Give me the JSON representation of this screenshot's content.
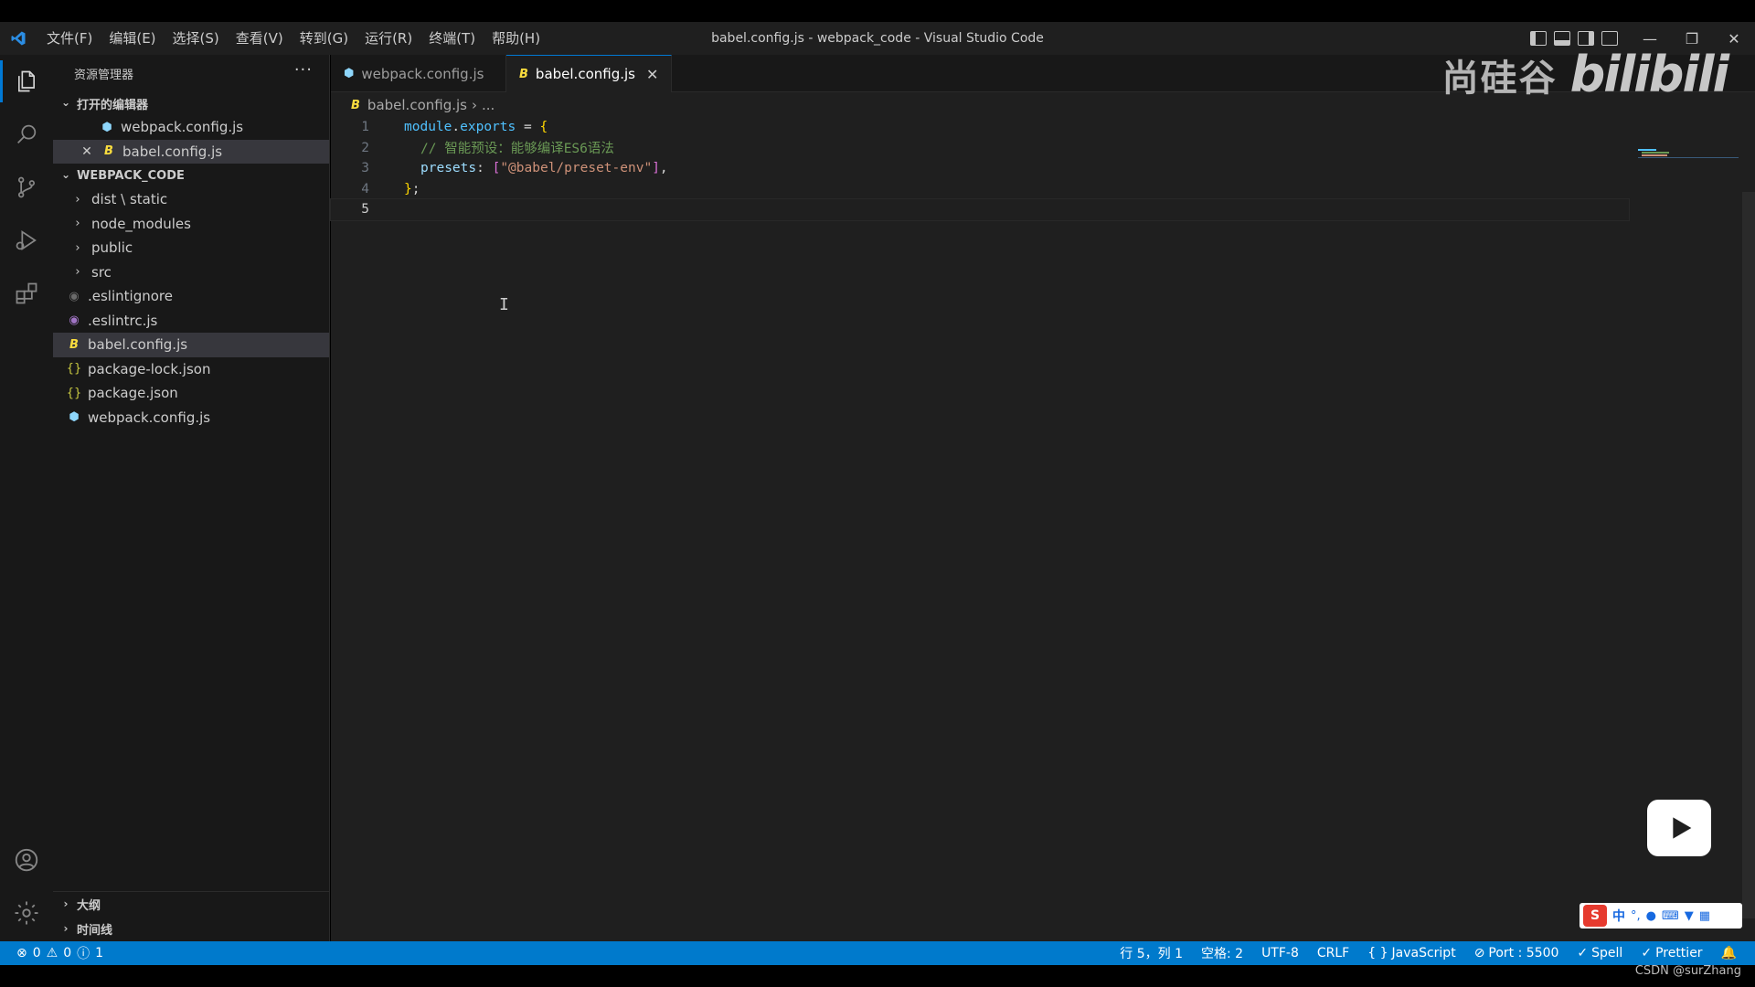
{
  "window": {
    "title": "babel.config.js - webpack_code - Visual Studio Code"
  },
  "menu": [
    "文件(F)",
    "编辑(E)",
    "选择(S)",
    "查看(V)",
    "转到(G)",
    "运行(R)",
    "终端(T)",
    "帮助(H)"
  ],
  "sidebar": {
    "header": "资源管理器",
    "more": "···",
    "open_editors": {
      "title": "打开的编辑器",
      "items": [
        {
          "label": "webpack.config.js",
          "icon": "webpack-icon"
        },
        {
          "label": "babel.config.js",
          "icon": "babel-icon",
          "selected": true
        }
      ]
    },
    "project": {
      "title": "WEBPACK_CODE",
      "items": [
        {
          "label": "dist \\ static",
          "type": "folder"
        },
        {
          "label": "node_modules",
          "type": "folder"
        },
        {
          "label": "public",
          "type": "folder"
        },
        {
          "label": "src",
          "type": "folder"
        },
        {
          "label": ".eslintignore",
          "type": "file",
          "icon": "eslintignore-icon"
        },
        {
          "label": ".eslintrc.js",
          "type": "file",
          "icon": "eslint-icon"
        },
        {
          "label": "babel.config.js",
          "type": "file",
          "icon": "babel-icon",
          "selected": true
        },
        {
          "label": "package-lock.json",
          "type": "file",
          "icon": "json-icon"
        },
        {
          "label": "package.json",
          "type": "file",
          "icon": "json-icon"
        },
        {
          "label": "webpack.config.js",
          "type": "file",
          "icon": "webpack-icon"
        }
      ]
    },
    "bottom": [
      "大纲",
      "时间线"
    ]
  },
  "tabs": [
    {
      "label": "webpack.config.js",
      "active": false
    },
    {
      "label": "babel.config.js",
      "active": true,
      "close": "✕"
    }
  ],
  "breadcrumb": {
    "file": "babel.config.js",
    "rest": "..."
  },
  "code": {
    "line_numbers": [
      "1",
      "2",
      "3",
      "4",
      "5"
    ],
    "line1_var": "module",
    "line1_dot": ".",
    "line1_prop": "exports",
    "line1_op": " = ",
    "line1_brace": "{",
    "line2_comment": "// 智能预设：能够编译ES6语法",
    "line3_key": "presets",
    "line3_colon": ": ",
    "line3_open": "[",
    "line3_str": "\"@babel/preset-env\"",
    "line3_close": "]",
    "line3_comma": ",",
    "line4_brace": "}",
    "line4_semi": ";"
  },
  "watermark": {
    "brand": "尚硅谷",
    "site": "bilibili"
  },
  "ime": {
    "logo": "S",
    "mode": "中",
    "punct": "°,"
  },
  "status": {
    "errors": "0",
    "warnings": "0",
    "info": "1",
    "position": "行 5，列 1",
    "spaces": "空格: 2",
    "encoding": "UTF-8",
    "eol": "CRLF",
    "language": "JavaScript",
    "port": "Port : 5500",
    "spell": "Spell",
    "prettier": "Prettier"
  },
  "credit": "CSDN @surZhang",
  "colors": {
    "accent": "#0078d4",
    "statusbar": "#007acc",
    "babel": "#f9dc3e",
    "webpack": "#8ed6fb",
    "eslint": "#a074c4",
    "json": "#cbcb41"
  }
}
